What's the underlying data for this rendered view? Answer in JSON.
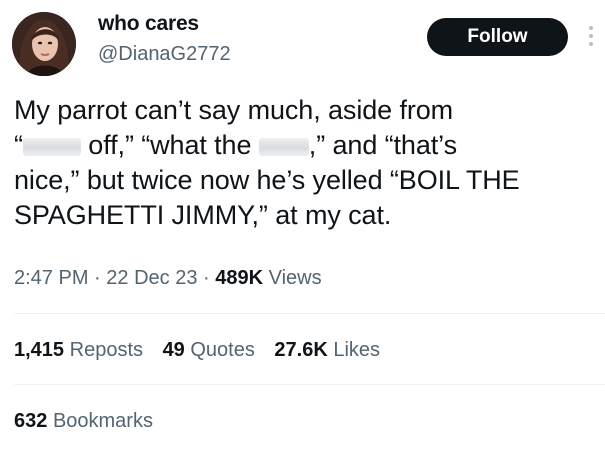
{
  "author": {
    "display_name": "who cares",
    "handle": "@DianaG2772"
  },
  "actions": {
    "follow_label": "Follow"
  },
  "tweet": {
    "line1": "My parrot can’t say much, aside from",
    "line2_a": "“",
    "line2_b": " off,” “what the ",
    "line2_c": ",” and “that’s",
    "line3": "nice,” but twice now he’s yelled “BOIL THE",
    "line4": "SPAGHETTI JIMMY,” at my cat."
  },
  "meta": {
    "time": "2:47 PM",
    "sep1": " · ",
    "date": "22 Dec 23",
    "sep2": " · ",
    "views_count": "489K",
    "views_label": " Views"
  },
  "stats": {
    "reposts_count": "1,415",
    "reposts_label": "Reposts",
    "quotes_count": "49",
    "quotes_label": "Quotes",
    "likes_count": "27.6K",
    "likes_label": "Likes",
    "bookmarks_count": "632",
    "bookmarks_label": "Bookmarks"
  },
  "colors": {
    "text": "#0f1419",
    "secondary": "#536471",
    "follow_bg": "#0f1419",
    "divider": "#eff3f4"
  },
  "icons": {
    "more": "more-vertical-icon"
  }
}
